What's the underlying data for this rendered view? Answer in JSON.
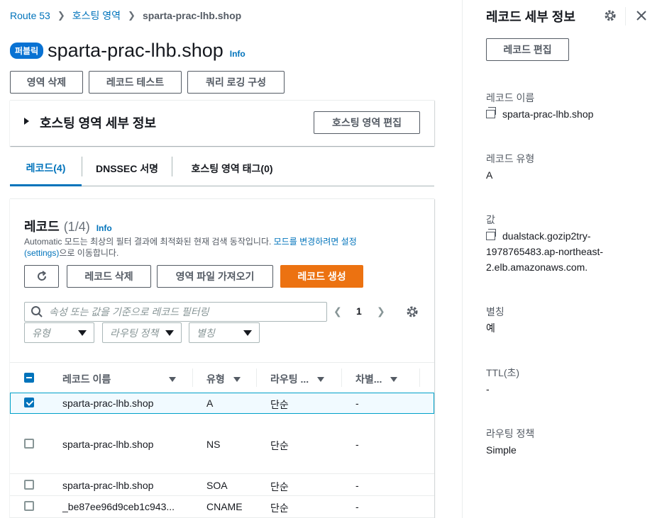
{
  "breadcrumb": {
    "items": [
      "Route 53",
      "호스팅 영역",
      "sparta-prac-lhb.shop"
    ]
  },
  "header": {
    "badge": "퍼블릭",
    "title": "sparta-prac-lhb.shop",
    "info": "Info"
  },
  "actions": {
    "delete_zone": "영역 삭제",
    "test_record": "레코드 테스트",
    "query_logging": "쿼리 로깅 구성"
  },
  "hosted_zone_details": {
    "title": "호스팅 영역 세부 정보",
    "edit_button": "호스팅 영역 편집"
  },
  "tabs": [
    {
      "label": "레코드(4)",
      "active": true
    },
    {
      "label": "DNSSEC 서명",
      "active": false
    },
    {
      "label": "호스팅 영역 태그(0)",
      "active": false
    }
  ],
  "records": {
    "title": "레코드",
    "count": "(1/4)",
    "info": "Info",
    "desc_prefix": "Automatic 모드는 최상의 필터 결과에 최적화된 현재 검색 동작입니다. ",
    "desc_link": "모드를 변경하려면 설정 (settings)",
    "desc_suffix": "으로 이동합니다.",
    "refresh_icon": "refresh-icon",
    "delete_button": "레코드 삭제",
    "import_button": "영역 파일 가져오기",
    "create_button": "레코드 생성",
    "search_placeholder": "속성 또는 값을 기준으로 레코드 필터링",
    "page": "1",
    "filters": [
      "유형",
      "라우팅 정책",
      "별칭"
    ],
    "columns": [
      "레코드 이름",
      "유형",
      "라우팅 ...",
      "차별..."
    ],
    "rows": [
      {
        "name": "sparta-prac-lhb.shop",
        "type": "A",
        "routing": "단순",
        "diff": "-",
        "selected": true
      },
      {
        "name": "sparta-prac-lhb.shop",
        "type": "NS",
        "routing": "단순",
        "diff": "-",
        "selected": false
      },
      {
        "name": "sparta-prac-lhb.shop",
        "type": "SOA",
        "routing": "단순",
        "diff": "-",
        "selected": false
      },
      {
        "name": "_be87ee96d9ceb1c943...",
        "type": "CNAME",
        "routing": "단순",
        "diff": "-",
        "selected": false
      }
    ]
  },
  "detail_panel": {
    "title": "레코드 세부 정보",
    "edit_button": "레코드 편집",
    "fields": [
      {
        "label": "레코드 이름",
        "value": "sparta-prac-lhb.shop",
        "copy": true
      },
      {
        "label": "레코드 유형",
        "value": "A",
        "copy": false
      },
      {
        "label": "값",
        "value_lines": [
          "dualstack.gozip2try-",
          "1978765483.ap-northeast-",
          "2.elb.amazonaws.com."
        ],
        "copy": true
      },
      {
        "label": "별칭",
        "value": "예",
        "copy": false
      },
      {
        "label": "TTL(초)",
        "value": "-",
        "copy": false
      },
      {
        "label": "라우팅 정책",
        "value": "Simple",
        "copy": false
      }
    ]
  },
  "colors": {
    "link": "#0073bb",
    "primary": "#ec7211",
    "badge": "#0972d3"
  }
}
